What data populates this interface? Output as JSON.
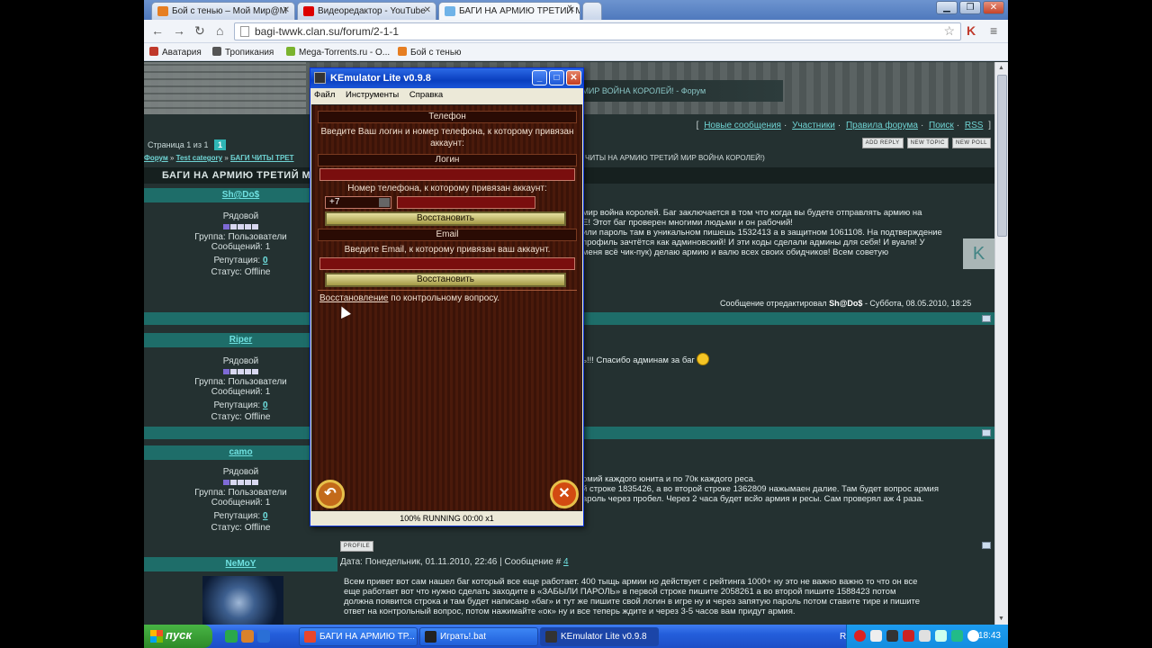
{
  "browser": {
    "tabs": [
      {
        "title": "Бой с тенью – Мой Мир@M",
        "icon": "mail-ru-icon"
      },
      {
        "title": "Видеоредактор - YouTube",
        "icon": "youtube-icon"
      },
      {
        "title": "БАГИ НА АРМИЮ ТРЕТИЙ М",
        "icon": "clan-icon"
      }
    ],
    "url": "bagi-twwk.clan.su/forum/2-1-1",
    "bookmarks": [
      {
        "label": "Аватария",
        "color": "#c0392b"
      },
      {
        "label": "Тропикания",
        "color": "#555555"
      },
      {
        "label": "Mega-Torrents.ru - О...",
        "color": "#7bb32e"
      },
      {
        "label": "Бой с тенью",
        "color": "#e67e22"
      }
    ]
  },
  "forum": {
    "banner_text": "ТРЕТИЙ МИР ВОЙНА КОРОЛЕЙ! - Форум",
    "top_links": {
      "new_messages": "Новые сообщения",
      "members": "Участники",
      "rules": "Правила форума",
      "search": "Поиск",
      "rss": "RSS"
    },
    "pager": {
      "text": "Страница 1 из 1",
      "current": "1"
    },
    "buttons": {
      "reply": "ADD REPLY",
      "topic": "NEW TOPIC",
      "poll": "NEW POLL"
    },
    "breadcrumb": {
      "forum": "Форум",
      "category": "Test category",
      "topic": "БАГИ ЧИТЫ ТРЕТ",
      "tail": "ЧИТЫ НА АРМИЮ ТРЕТИЙ МИР ВОЙНА КОРОЛЕЙ!)"
    },
    "topic_title": "БАГИ НА АРМИЮ ТРЕТИЙ М",
    "posts": [
      {
        "author": "Sh@Do$",
        "rank": "Рядовой",
        "group": "Группа: Пользователи",
        "messages": "Сообщений: 1",
        "rep_label": "Репутация:",
        "rep": "0",
        "status": "Статус: Offline",
        "lines": [
          "мир война королей. Баг заключается в том что когда вы будете отправлять армию на",
          "E! Этот баг проверен многими людьми и он рабочий!",
          "или пароль там в уникальном пишешь 1532413 а в защитном 1061108. На подтверждение",
          "профиль зачтётся как админовский! И эти коды сделали админы для себя! И вуаля! У",
          "меня всё чик-пук) делаю армию и валю всех своих обидчиков! Всем советую"
        ],
        "edit_prefix": "Сообщение отредактировал",
        "edit_author": "Sh@Do$",
        "edit_date": "- Суббота, 08.05.2010, 18:25"
      },
      {
        "author": "Riper",
        "rank": "Рядовой",
        "group": "Группа: Пользователи",
        "messages": "Сообщений: 1",
        "rep_label": "Репутация:",
        "rep": "0",
        "status": "Статус: Offline",
        "lines": [
          "ь!!! Спасибо админам за баг"
        ]
      },
      {
        "author": "camo",
        "rank": "Рядовой",
        "group": "Группа: Пользователи",
        "messages": "Сообщений: 1",
        "rep_label": "Репутация:",
        "rep": "0",
        "status": "Статус: Offline",
        "lines": [
          "рмий каждого юнита и по 70к каждого реса.",
          "й строке 1835426, а во второй строке 1362809 нажымаен далие. Там будет вопрос армия",
          "ароль через пробел. Через 2 часа будет всйо армия и ресы. Сам проверял аж 4 раза."
        ],
        "profile_btn": "PROFILE"
      },
      {
        "author": "NeMoY",
        "date_label": "Дата: Понедельник, 01.11.2010, 22:46 | Сообщение #",
        "msg_no": "4",
        "lines": [
          "Всем привет вот сам нашел баг который все еще работает. 400 тыщь армии но действует с рейтинга 1000+ ну это не важно важно то что он все",
          "еще работает вот что нужно сделать заходите в «ЗАБЫЛИ ПАРОЛЬ» в первой строке пишите 2058261 а во второй пишите 1588423 потом",
          "должна появится строка и там будет написано «баг» и тут же пишите свой логин в игре ну и через запятую пароль потом ставите тире и пишите",
          "ответ на контрольный вопрос, потом нажимайте «ок» ну и все теперь ждите и через 3-5 часов вам придут армия."
        ]
      }
    ]
  },
  "kemulator": {
    "title": "KEmulator Lite v0.9.8",
    "menu": [
      "Файл",
      "Инструменты",
      "Справка"
    ],
    "phone_header": "Телефон",
    "phone_hint": "Введите Ваш логин и номер телефона, к которому привязан аккаунт:",
    "login_header": "Логин",
    "phone_label": "Номер телефона, к которому привязан аккаунт:",
    "country_code": "+7",
    "restore_btn": "Восстановить",
    "email_header": "Email",
    "email_hint": "Введите Email, к которому привязан ваш аккаунт.",
    "restore_btn2": "Восстановить",
    "question_link": "Восстановление",
    "question_text": " по контрольному вопросу.",
    "status": "100% RUNNING 00:00 x1"
  },
  "taskbar": {
    "start": "пуск",
    "items": [
      {
        "label": "БАГИ НА АРМИЮ ТР...",
        "icon_color": "#e8462c"
      },
      {
        "label": "Играть!.bat",
        "icon_color": "#222222"
      },
      {
        "label": "KEmulator Lite v0.9.8",
        "icon_color": "#333333"
      }
    ],
    "lang": "RU",
    "clock": "18:43"
  },
  "colors": {
    "accent": "#1e6d69",
    "link": "#6fe0e0",
    "xp_blue": "#245edb"
  }
}
